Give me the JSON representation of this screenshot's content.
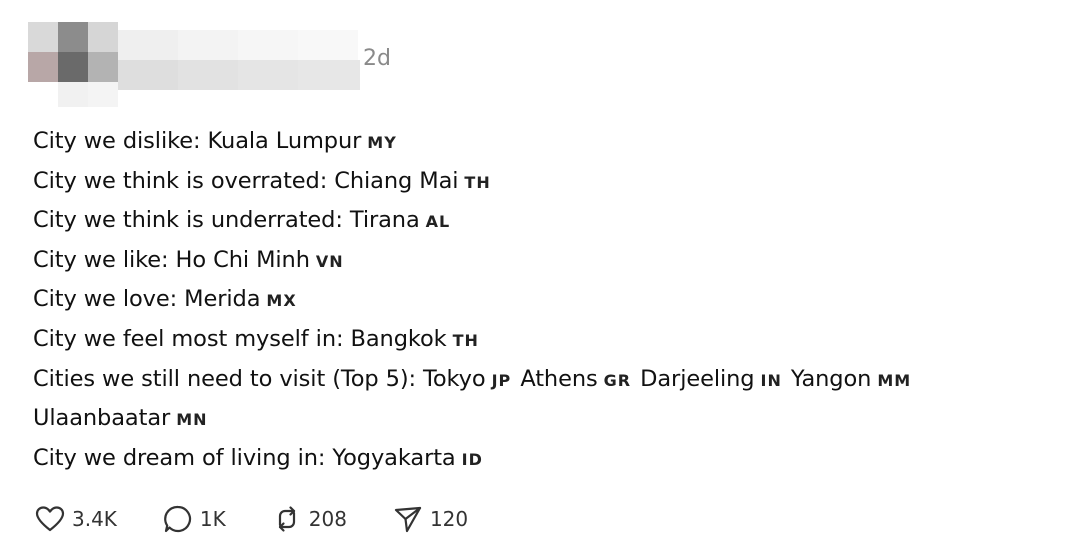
{
  "post": {
    "timestamp": "2d",
    "lines": [
      {
        "text": "City we dislike: Kuala Lumpur",
        "flags": [
          "MY"
        ]
      },
      {
        "text": "City we think is overrated: Chiang Mai",
        "flags": [
          "TH"
        ]
      },
      {
        "text": "City we think is underrated: Tirana",
        "flags": [
          "AL"
        ]
      },
      {
        "text": "City we like: Ho Chi Minh",
        "flags": [
          "VN"
        ]
      },
      {
        "text": "City we love: Merida",
        "flags": [
          "MX"
        ]
      },
      {
        "text": "City we feel most myself in: Bangkok",
        "flags": [
          "TH"
        ]
      },
      {
        "text": "Cities we still need to visit (Top 5): Tokyo",
        "segments": [
          {
            "flag": "JP",
            "after": "Athens"
          },
          {
            "flag": "GR",
            "after": "Darjeeling"
          },
          {
            "flag": "IN",
            "after": "Yangon"
          },
          {
            "flag": "MM",
            "after": ""
          }
        ]
      },
      {
        "text": "Ulaanbaatar",
        "flags": [
          "MN"
        ]
      },
      {
        "text": "City we dream of living in: Yogyakarta",
        "flags": [
          "ID"
        ]
      }
    ],
    "actions": {
      "likes": "3.4K",
      "replies": "1K",
      "reposts": "208",
      "shares": "120"
    }
  },
  "icons": {
    "like": "heart-icon",
    "reply": "comment-bubble-icon",
    "repost": "repost-arrows-icon",
    "share": "send-paper-plane-icon"
  },
  "colors": {
    "text": "#111111",
    "muted": "#8a8a8a",
    "background": "#ffffff"
  }
}
